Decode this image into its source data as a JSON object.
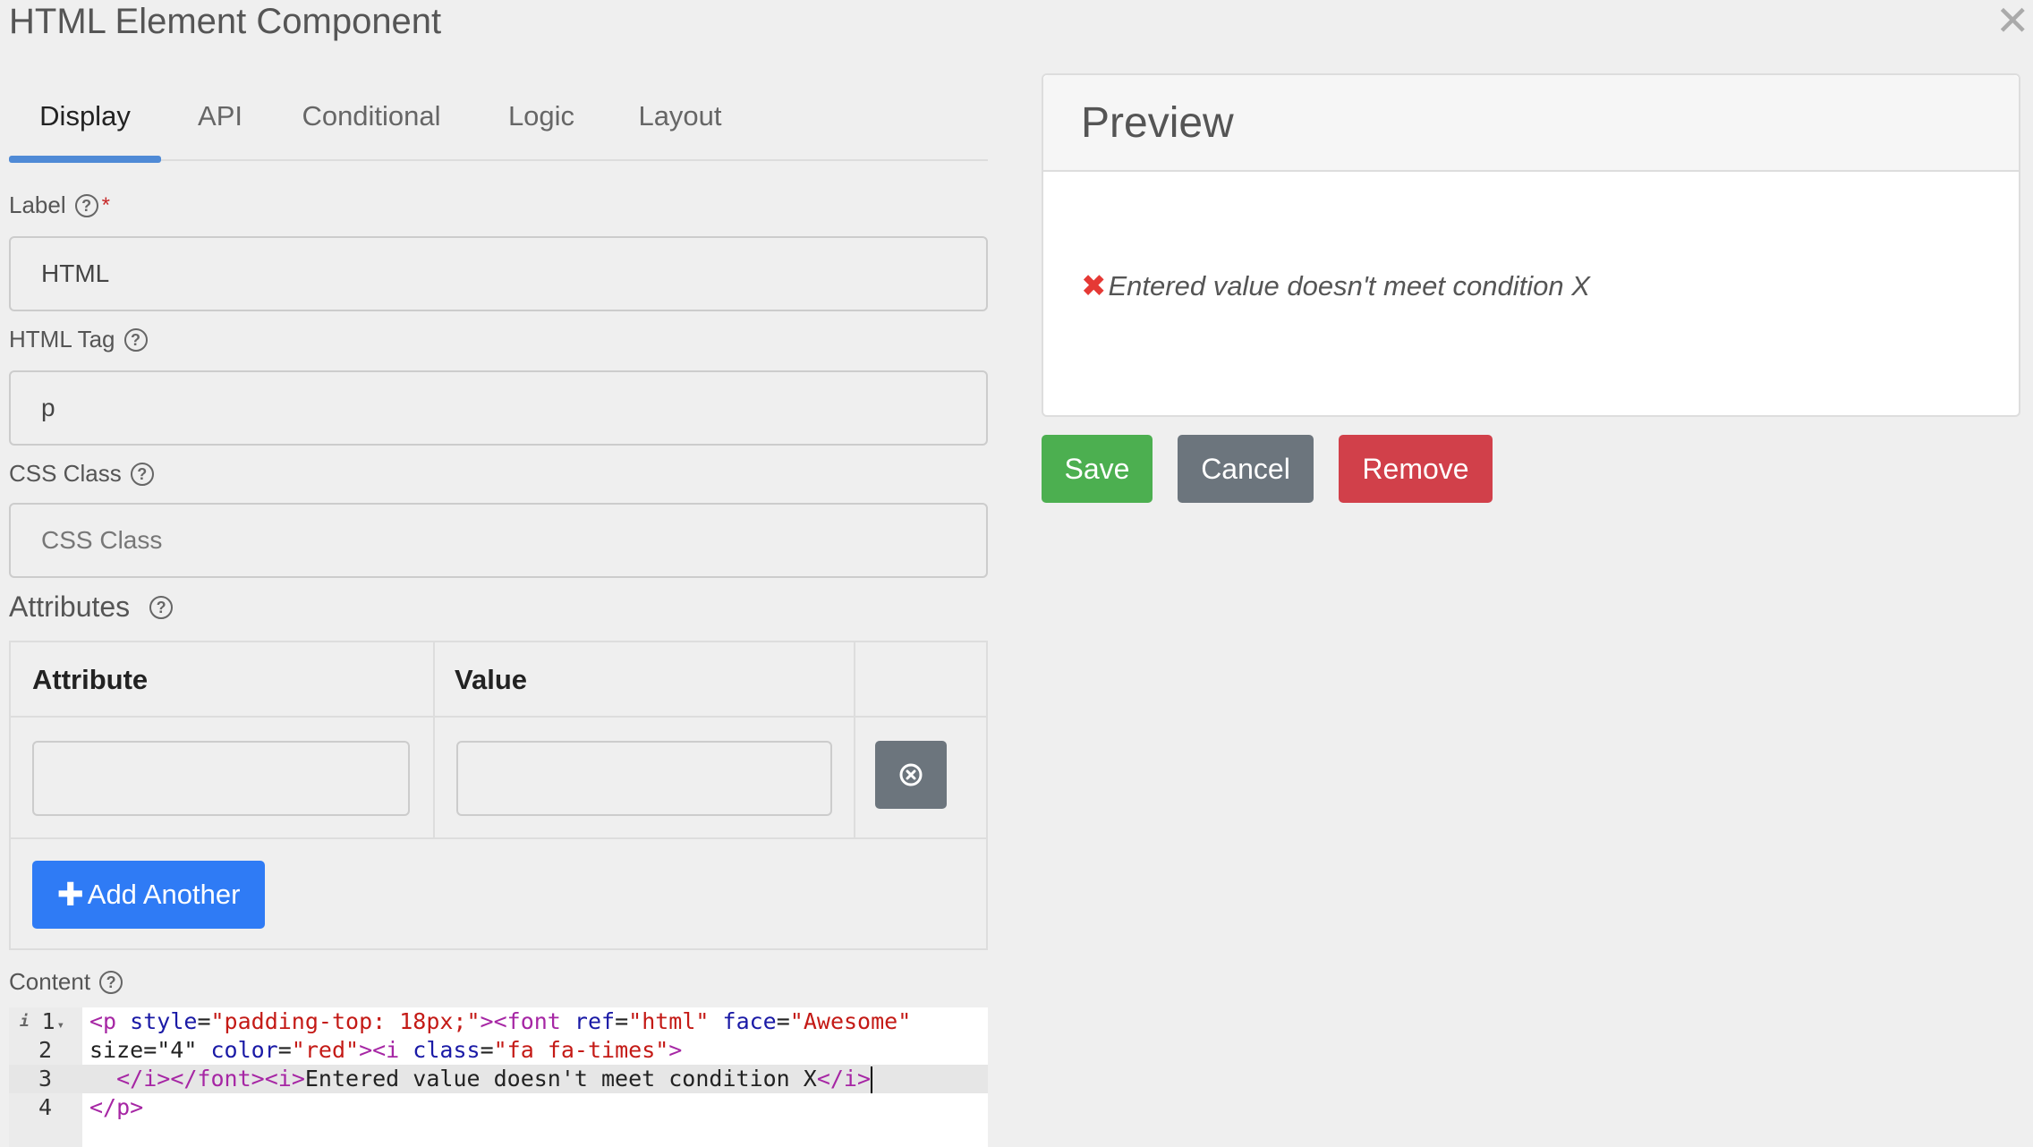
{
  "dialog": {
    "title": "HTML Element Component"
  },
  "tabs": [
    {
      "label": "Display",
      "active": true
    },
    {
      "label": "API",
      "active": false
    },
    {
      "label": "Conditional",
      "active": false
    },
    {
      "label": "Logic",
      "active": false
    },
    {
      "label": "Layout",
      "active": false
    }
  ],
  "fields": {
    "label": {
      "label": "Label",
      "required_mark": "*",
      "value": "HTML"
    },
    "html_tag": {
      "label": "HTML Tag",
      "value": "p"
    },
    "css_class": {
      "label": "CSS Class",
      "placeholder": "CSS Class"
    }
  },
  "attributes": {
    "label": "Attributes",
    "columns": [
      "Attribute",
      "Value"
    ],
    "rows": [
      {
        "attribute": "",
        "value": ""
      }
    ],
    "add_button": "Add Another"
  },
  "content": {
    "label": "Content",
    "lines": [
      {
        "num": "1",
        "text": "<p style=\"padding-top: 18px;\"><font ref=\"html\" face=\"Awesome\""
      },
      {
        "num": "2",
        "text": "size=\"4\" color=\"red\"><i class=\"fa fa-times\">"
      },
      {
        "num": "3",
        "text": "  </i></font><i>Entered value doesn't meet condition X</i>"
      },
      {
        "num": "4",
        "text": "</p>"
      }
    ]
  },
  "preview": {
    "title": "Preview",
    "icon": "times-icon",
    "text": "Entered value doesn't meet condition X",
    "icon_color": "#e53935"
  },
  "actions": {
    "save": {
      "label": "Save",
      "color": "#4caf50"
    },
    "cancel": {
      "label": "Cancel",
      "color": "#6c757d"
    },
    "remove": {
      "label": "Remove",
      "color": "#d1404a"
    }
  },
  "colors": {
    "accent": "#2f7bf5",
    "tab_underline": "#4f8ad6"
  }
}
